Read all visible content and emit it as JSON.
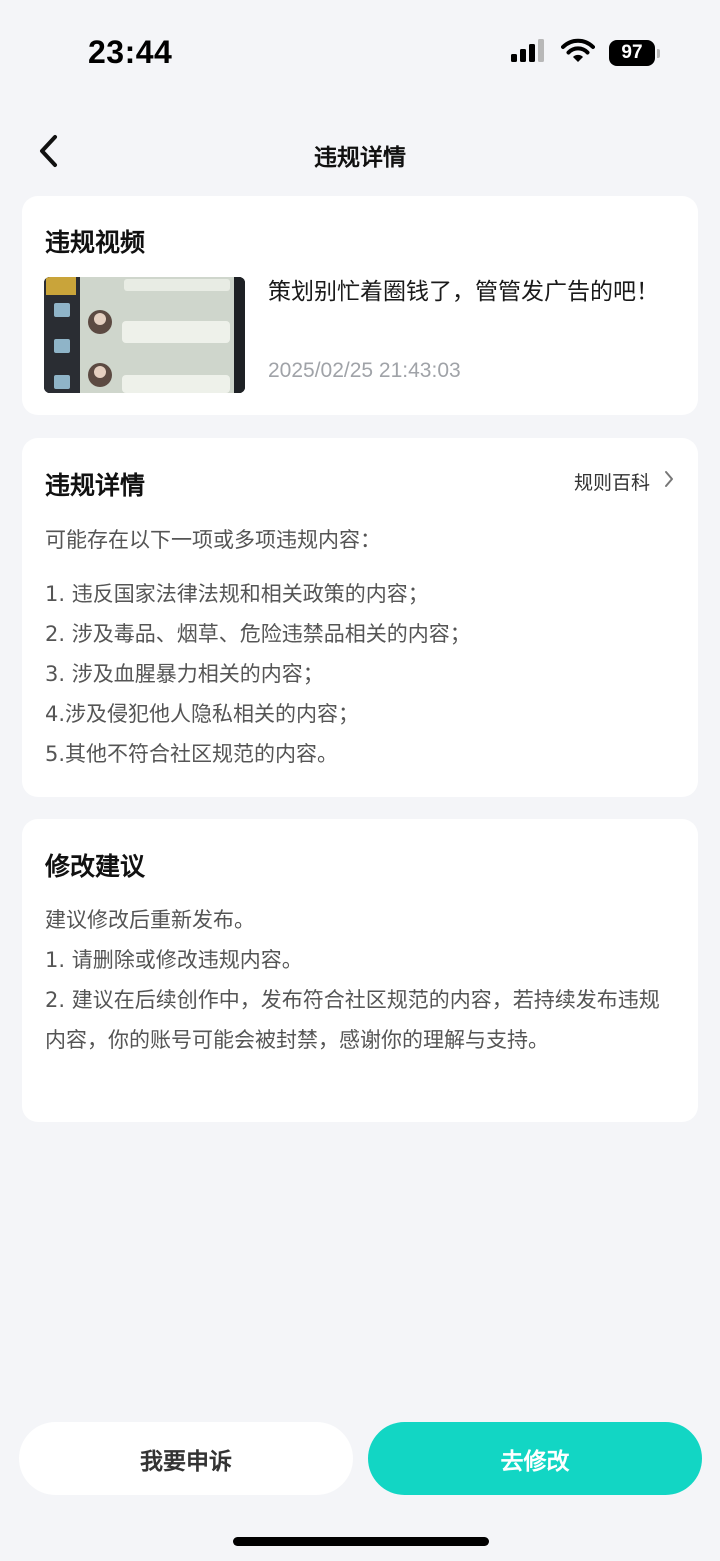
{
  "status_bar": {
    "time": "23:44",
    "battery": "97"
  },
  "nav": {
    "title": "违规详情"
  },
  "video_card": {
    "title": "违规视频",
    "caption": "策划别忙着圈钱了，管管发广告的吧！",
    "timestamp": "2025/02/25 21:43:03"
  },
  "detail_card": {
    "title": "违规详情",
    "rules_link": "规则百科",
    "intro": "可能存在以下一项或多项违规内容：",
    "items": [
      "1. 违反国家法律法规和相关政策的内容；",
      "2. 涉及毒品、烟草、危险违禁品相关的内容；",
      "3. 涉及血腥暴力相关的内容；",
      "4.涉及侵犯他人隐私相关的内容；",
      "5.其他不符合社区规范的内容。"
    ]
  },
  "suggest_card": {
    "title": "修改建议",
    "lines": [
      "建议修改后重新发布。",
      "1. 请删除或修改违规内容。",
      "2. 建议在后续创作中，发布符合社区规范的内容，若持续发布违规内容，你的账号可能会被封禁，感谢你的理解与支持。"
    ]
  },
  "buttons": {
    "appeal": "我要申诉",
    "modify": "去修改"
  },
  "colors": {
    "accent": "#12d6c4",
    "background": "#f4f5f8"
  }
}
